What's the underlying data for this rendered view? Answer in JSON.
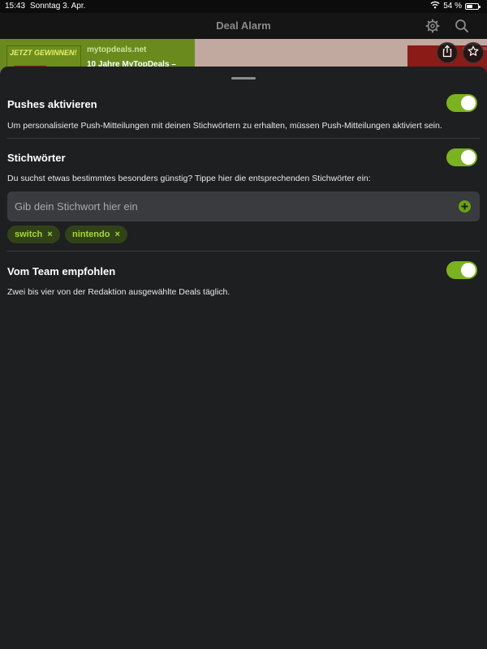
{
  "statusbar": {
    "time": "15:43",
    "date": "Sonntag 3. Apr.",
    "battery": "54 %",
    "battery_level": 0.54,
    "icons": [
      "wifi-icon",
      "battery-icon"
    ]
  },
  "navbar": {
    "title": "Deal Alarm",
    "icons": [
      "gear-icon",
      "search-icon"
    ]
  },
  "banner": {
    "promo_text": "JETZT GEWINNEN!",
    "site": "mytopdeals.net",
    "title": "10 Jahre MyTopDeals –",
    "icons": [
      "share-icon",
      "star-icon"
    ]
  },
  "settings": {
    "pushes": {
      "title": "Pushes aktivieren",
      "description": "Um personalisierte Push-Mitteilungen mit deinen Stichwörtern zu erhalten, müssen Push-Mitteilungen aktiviert sein.",
      "enabled": true
    },
    "keywords": {
      "title": "Stichwörter",
      "description": "Du suchst etwas bestimmtes besonders günstig? Tippe hier die entsprechenden Stichwörter ein:",
      "enabled": true,
      "input_placeholder": "Gib dein Stichwort hier ein",
      "input_value": "",
      "chips": [
        {
          "label": "switch",
          "remove": "×"
        },
        {
          "label": "nintendo",
          "remove": "×"
        }
      ]
    },
    "team": {
      "title": "Vom Team empfohlen",
      "description": "Zwei bis vier von der Redaktion ausgewählte Deals täglich.",
      "enabled": true
    }
  },
  "colors": {
    "accent": "#7bb21f",
    "sheet_background": "#1e1f21",
    "chip_background": "#324218",
    "chip_text": "#a5d83a"
  }
}
